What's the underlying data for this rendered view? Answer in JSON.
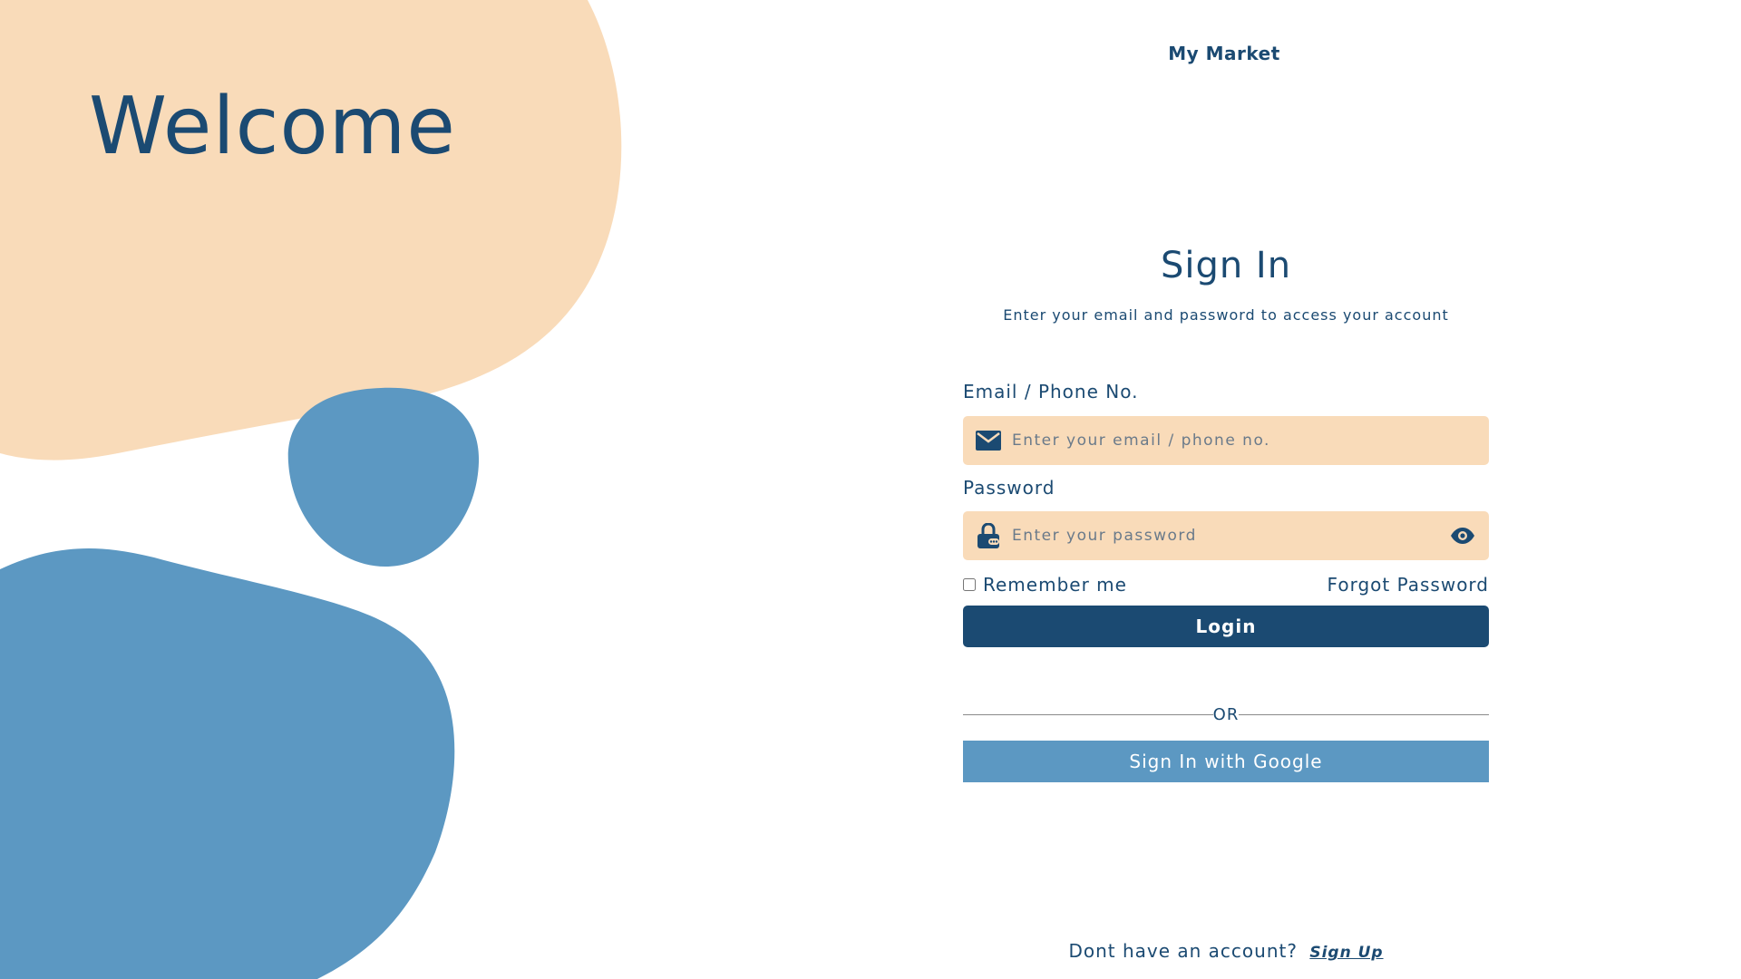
{
  "brand": {
    "name": "My Market"
  },
  "hero": {
    "welcome_text": "Welcome"
  },
  "signin": {
    "title": "Sign In",
    "subtitle": "Enter your email and password to access your account",
    "email_label": "Email / Phone No.",
    "email_placeholder": "Enter your email / phone no.",
    "email_icon": "envelope-icon",
    "password_label": "Password",
    "password_placeholder": "Enter your password",
    "password_icon": "lock-icon",
    "show_password_icon": "eye-icon",
    "remember_label": "Remember me",
    "forgot_label": "Forgot Password",
    "login_label": "Login",
    "divider_label": "OR",
    "google_label": "Sign In with Google"
  },
  "footer": {
    "prompt": "Dont have an account?",
    "signup_label": "Sign Up"
  },
  "colors": {
    "primary": "#1b4a72",
    "peach": "#f9dbb9",
    "blue": "#5c98c2",
    "background": "#ffffff"
  }
}
